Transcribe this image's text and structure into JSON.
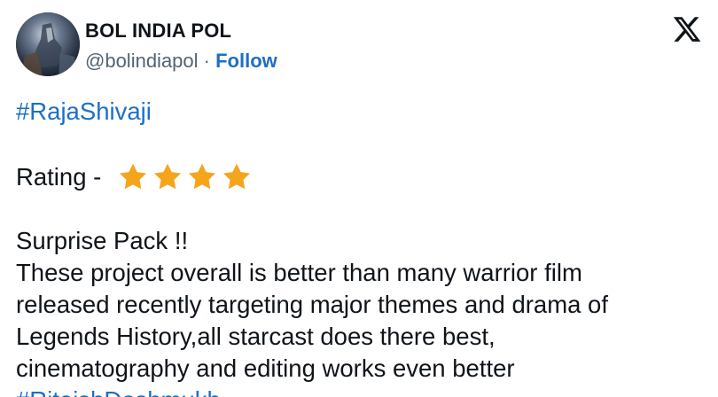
{
  "author": {
    "name": "BOL INDIA POL",
    "handle": "@bolindiapol",
    "separator": " · ",
    "follow_label": "Follow",
    "avatar_icon": "profile-avatar"
  },
  "brand": {
    "logo_icon": "x-logo-icon"
  },
  "tweet": {
    "hashtag_1": "#RajaShivaji",
    "rating_label": "Rating - ",
    "rating_stars": 4,
    "star_color": "#f4a51c",
    "line_1": "Surprise Pack !!",
    "line_2": "These project overall is better than many warrior film",
    "line_3": "released recently targeting major themes and drama of",
    "line_4": "Legends History,all starcast does there best,",
    "line_5": "cinematography and editing works even better",
    "hashtag_2": "#RiteishDeshmukh"
  },
  "colors": {
    "link": "#1d6fc4",
    "text": "#0f1419",
    "muted": "#536471"
  }
}
